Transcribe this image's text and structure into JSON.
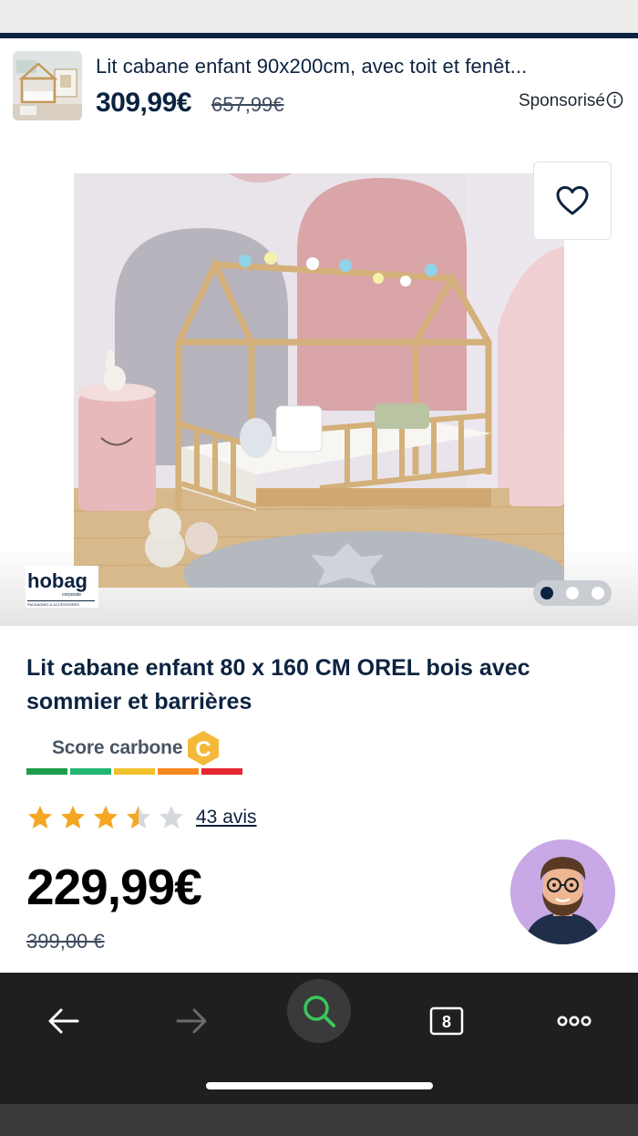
{
  "sponsored": {
    "title": "Lit cabane enfant 90x200cm, avec toit et fenêt...",
    "price": "309,99€",
    "old_price": "657,99€",
    "label": "Sponsorisé"
  },
  "gallery": {
    "brand_logo_text": "hobag",
    "dots_total": 3,
    "active_dot": 1
  },
  "product": {
    "title": "Lit cabane enfant 80 x 160 CM OREL bois avec sommier et barrières",
    "carbon_label": "Score carbone",
    "carbon_grade": "C",
    "rating": 3.5,
    "rating_max": 5,
    "reviews": "43 avis",
    "price": "229,99€",
    "old_price": "399,00 €"
  },
  "toolbar": {
    "tab_count": "8"
  },
  "colors": {
    "navy": "#0c2340",
    "star": "#f5a623",
    "star_empty": "#d5d8dd",
    "carbon_badge": "#f4b93a",
    "carbon_scale": [
      "#1d9c4a",
      "#22b573",
      "#f2c12e",
      "#f48a1d",
      "#e52730"
    ]
  }
}
